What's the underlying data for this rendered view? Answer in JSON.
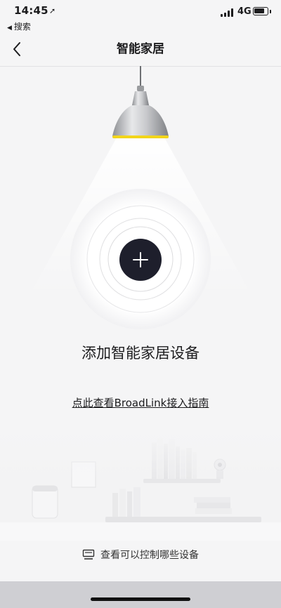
{
  "status_bar": {
    "time": "14:45",
    "back_app": "搜索",
    "network": "4G",
    "battery_level": 0.7
  },
  "nav": {
    "title": "智能家居"
  },
  "main": {
    "heading": "添加智能家居设备",
    "guide_link": "点此查看BroadLink接入指南",
    "devices_link": "查看可以控制哪些设备"
  },
  "icons": {
    "back": "chevron-left-icon",
    "add": "plus-icon",
    "devices": "monitor-icon",
    "location": "location-arrow-icon"
  },
  "colors": {
    "add_button": "#1e1f2c",
    "lamp_accent": "#f2d51a"
  }
}
